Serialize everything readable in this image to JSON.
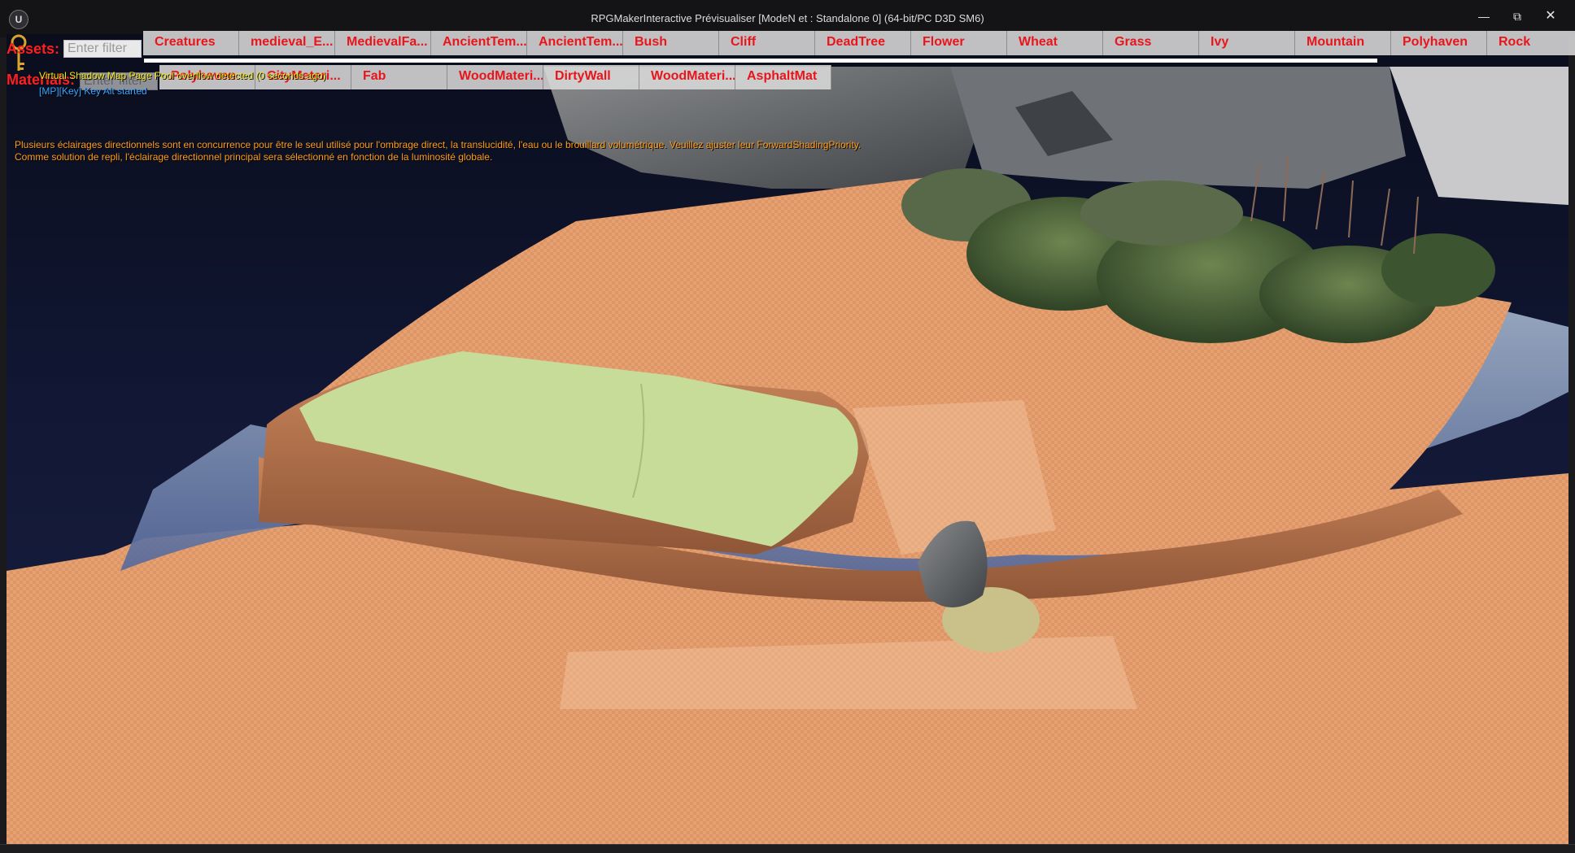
{
  "window": {
    "title": "RPGMakerInteractive Prévisualiser [ModeN et : Standalone 0]  (64-bit/PC D3D SM6)",
    "logo_icon": "unreal-engine-logo-icon",
    "controls": [
      "minimize-icon",
      "restore-icon",
      "close-icon"
    ]
  },
  "assets": {
    "label": "Assets:",
    "filter_placeholder": "Enter filter",
    "buttons": [
      "Creatures",
      "medieval_E...",
      "MedievalFa...",
      "AncientTem...",
      "AncientTem...",
      "Bush",
      "Cliff",
      "DeadTree",
      "Flower",
      "Wheat",
      "Grass",
      "Ivy",
      "Mountain",
      "Polyhaven",
      "Rock"
    ]
  },
  "materials": {
    "label": "Materials:",
    "filter_placeholder": "Enter filter",
    "buttons": [
      "Polyhaven",
      "CityMateri...",
      "Fab",
      "WoodMateri...",
      "DirtyWall",
      "WoodMateri...",
      "AsphaltMat"
    ]
  },
  "log": {
    "line1": "Virtual Shadow Map Page Pool overflow detected (0 seconds ago)",
    "line2": "[MP][Key] Key Alt started",
    "warning1": "Plusieurs éclairages directionnels sont en concurrence pour être le seul utilisé pour l'ombrage direct, la translucidité, l'eau ou le brouillard volumétrique. Veuillez ajuster leur ForwardShadingPriority.",
    "warning2": "Comme solution de repli, l'éclairage directionnel principal sera sélectionné en fonction de la luminosité globale."
  },
  "colors": {
    "ui_red": "#ff1f1f",
    "log_yellow": "#f2e61a",
    "log_cyan": "#3aa6ff",
    "log_orange": "#ff9d1a",
    "terrain_orange": "#e7a071",
    "water_blue": "#6d84a6",
    "grass_green": "#c8dc9a"
  },
  "scene": {
    "key_icon": "golden-key-icon"
  }
}
